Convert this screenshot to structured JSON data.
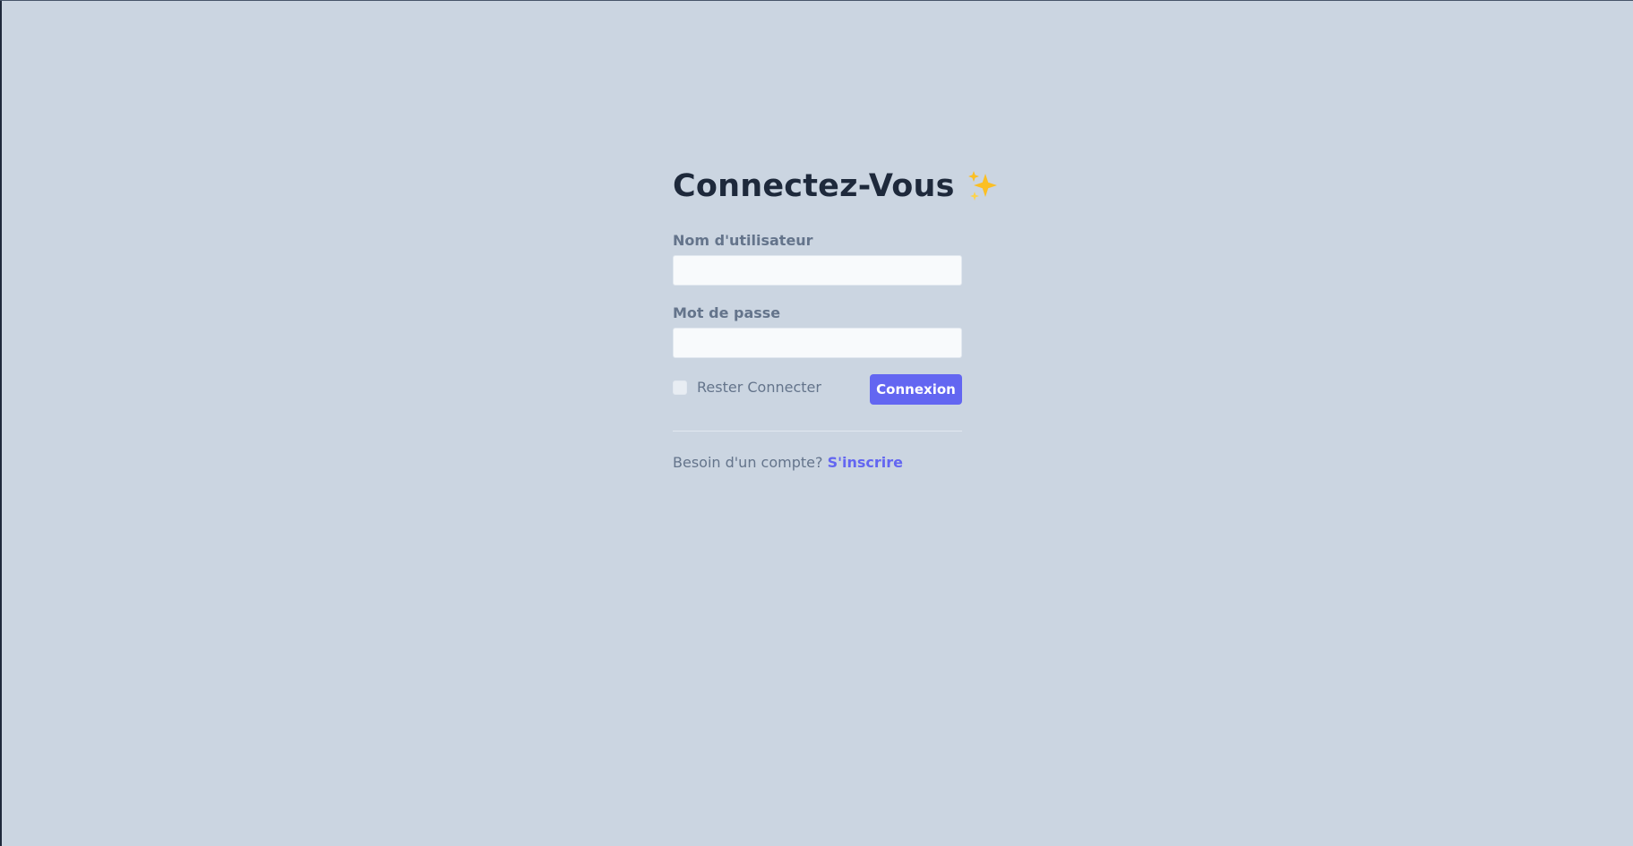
{
  "login": {
    "title": "Connectez-Vous",
    "title_icon": "sparkles-icon",
    "username_label": "Nom d'utilisateur",
    "username_value": "",
    "password_label": "Mot de passe",
    "password_value": "",
    "remember_label": "Rester Connecter",
    "remember_checked": false,
    "submit_label": "Connexion",
    "signup_prompt": "Besoin d'un compte?",
    "signup_link": "S'inscrire"
  },
  "colors": {
    "background": "#cbd5e1",
    "accent": "#6366f1",
    "title": "#1e293b",
    "muted_text": "#64748b",
    "sparkle": "#fbbf24"
  }
}
